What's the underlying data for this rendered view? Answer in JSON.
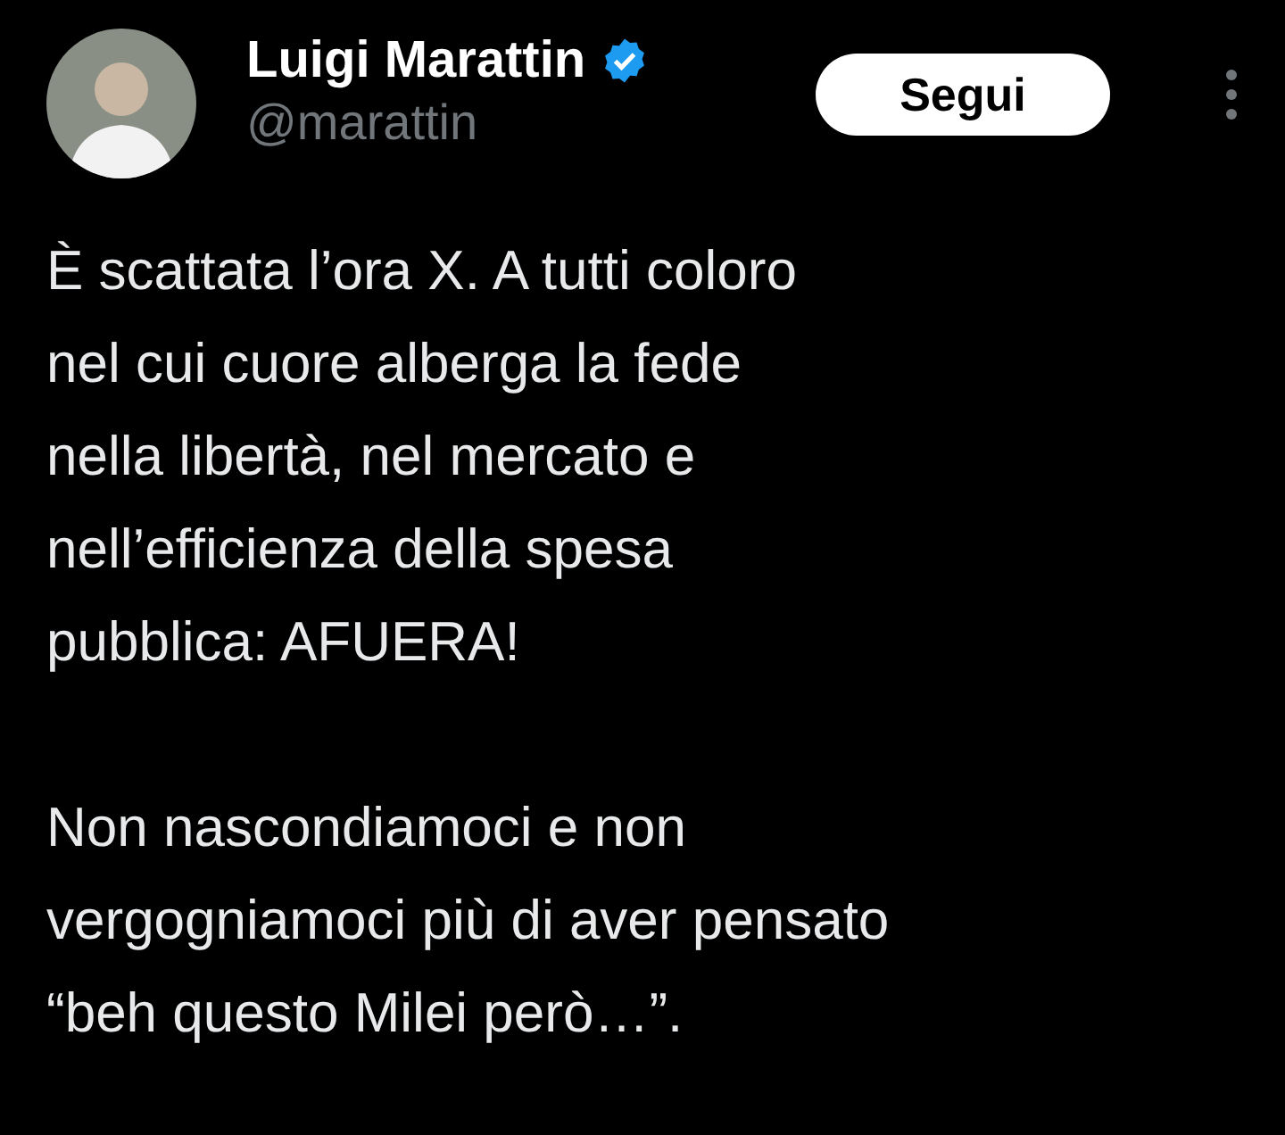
{
  "author": {
    "name": "Luigi Marattin",
    "verified": true,
    "handle": "@marattin"
  },
  "follow_button": {
    "label": "Segui"
  },
  "body": [
    "È scattata l’ora X. A tutti coloro\nnel cui cuore alberga la fede\nnella libertà, nel mercato e\nnell’efficienza della spesa\npubblica: AFUERA!",
    "Non nascondiamoci e non\nvergogniamoci più di aver pensato\n“beh questo Milei però…”."
  ]
}
